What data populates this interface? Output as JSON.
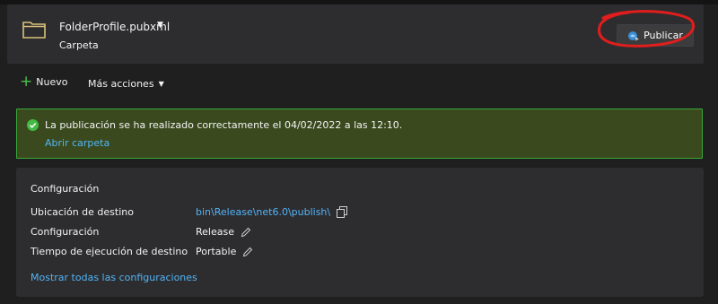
{
  "profile": {
    "name": "FolderProfile.pubxml",
    "type": "Carpeta",
    "publish_label": "Publicar"
  },
  "toolbar": {
    "new_label": "Nuevo",
    "more_label": "Más acciones"
  },
  "status": {
    "message": "La publicación se ha realizado correctamente el 04/02/2022 a las 12:10.",
    "link": "Abrir carpeta"
  },
  "settings": {
    "title": "Configuración",
    "rows": [
      {
        "label": "Ubicación de destino",
        "value": "bin\\Release\\net6.0\\publish\\"
      },
      {
        "label": "Configuración",
        "value": "Release"
      },
      {
        "label": "Tiempo de ejecución de destino",
        "value": "Portable"
      }
    ],
    "show_all": "Mostrar todas las configuraciones"
  },
  "icons": {
    "folder": "folder-icon",
    "publish": "publish-icon",
    "add": "plus-icon",
    "success": "check-circle-icon",
    "copy": "copy-icon",
    "edit": "pencil-icon"
  },
  "colors": {
    "link": "#52b4f5",
    "success_border": "#39a839",
    "success_bg": "#3a4a1e",
    "add_icon": "#4ec04e",
    "annotation": "#e11d1d"
  }
}
